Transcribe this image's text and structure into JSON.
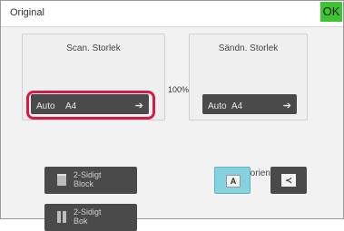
{
  "header": {
    "title": "Original",
    "ok_label": "OK"
  },
  "scan_size": {
    "label": "Scan. Storlek",
    "mode": "Auto",
    "size": "A4"
  },
  "send_size": {
    "label": "Sändn. Storlek",
    "mode": "Auto",
    "size": "A4"
  },
  "ratio": "100%",
  "duplex": {
    "block_label_line1": "2-Sidigt",
    "block_label_line2": "Block",
    "book_label_line1": "2-Sidigt",
    "book_label_line2": "Bok"
  },
  "orientation": {
    "label": "Bildorientering",
    "portrait_glyph": "A",
    "landscape_glyph": "≺",
    "selected": "portrait"
  },
  "colors": {
    "ok": "#3fc431",
    "highlight": "#d61a45",
    "selected": "#86d2df",
    "button": "#4a4a4a"
  },
  "icons": [
    "arrow-right-icon",
    "duplex-block-icon",
    "duplex-book-icon"
  ]
}
